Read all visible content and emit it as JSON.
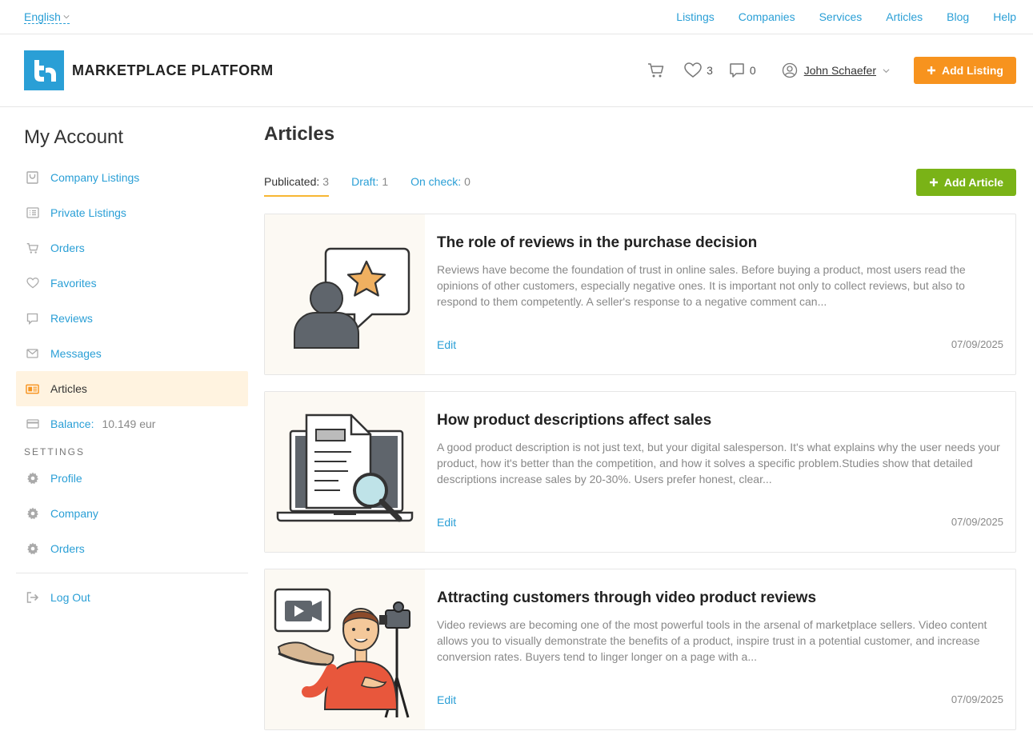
{
  "topbar": {
    "language": "English",
    "nav": [
      "Listings",
      "Companies",
      "Services",
      "Articles",
      "Blog",
      "Help"
    ]
  },
  "header": {
    "brand": "MARKETPLACE PLATFORM",
    "favorites_count": "3",
    "messages_count": "0",
    "user_name": "John Schaefer",
    "add_listing": "Add Listing"
  },
  "sidebar": {
    "title": "My Account",
    "items": [
      {
        "label": "Company Listings",
        "icon": "bag-icon"
      },
      {
        "label": "Private Listings",
        "icon": "list-icon"
      },
      {
        "label": "Orders",
        "icon": "cart-icon"
      },
      {
        "label": "Favorites",
        "icon": "heart-icon"
      },
      {
        "label": "Reviews",
        "icon": "comment-icon"
      },
      {
        "label": "Messages",
        "icon": "envelope-icon"
      },
      {
        "label": "Articles",
        "icon": "newspaper-icon"
      }
    ],
    "balance_label": "Balance:",
    "balance_value": "10.149 eur",
    "settings_label": "SETTINGS",
    "settings_items": [
      "Profile",
      "Company",
      "Orders"
    ],
    "logout": "Log Out"
  },
  "main": {
    "title": "Articles",
    "tabs": [
      {
        "label": "Publicated:",
        "count": "3"
      },
      {
        "label": "Draft:",
        "count": "1"
      },
      {
        "label": "On check:",
        "count": "0"
      }
    ],
    "add_article": "Add Article",
    "articles": [
      {
        "title": "The role of reviews in the purchase decision",
        "excerpt": "Reviews have become the foundation of trust in online sales. Before buying a product, most users read the opinions of other customers, especially negative ones. It is important not only to collect reviews, but also to respond to them competently. A seller's response to a negative comment can...",
        "edit": "Edit",
        "date": "07/09/2025"
      },
      {
        "title": "How product descriptions affect sales",
        "excerpt": "A good product description is not just text, but your digital salesperson. It's what explains why the user needs your product, how it's better than the competition, and how it solves a specific problem.Studies show that detailed descriptions increase sales by 20-30%. Users prefer honest, clear...",
        "edit": "Edit",
        "date": "07/09/2025"
      },
      {
        "title": "Attracting customers through video product reviews",
        "excerpt": "Video reviews are becoming one of the most powerful tools in the arsenal of marketplace sellers. Video content allows you to visually demonstrate the benefits of a product, inspire trust in a potential customer, and increase conversion rates. Buyers tend to linger longer on a page with a...",
        "edit": "Edit",
        "date": "07/09/2025"
      }
    ]
  },
  "colors": {
    "link": "#2a9fd6",
    "accent_orange": "#f7931e",
    "accent_green": "#7ab317",
    "active_bg": "#fff3e0"
  }
}
